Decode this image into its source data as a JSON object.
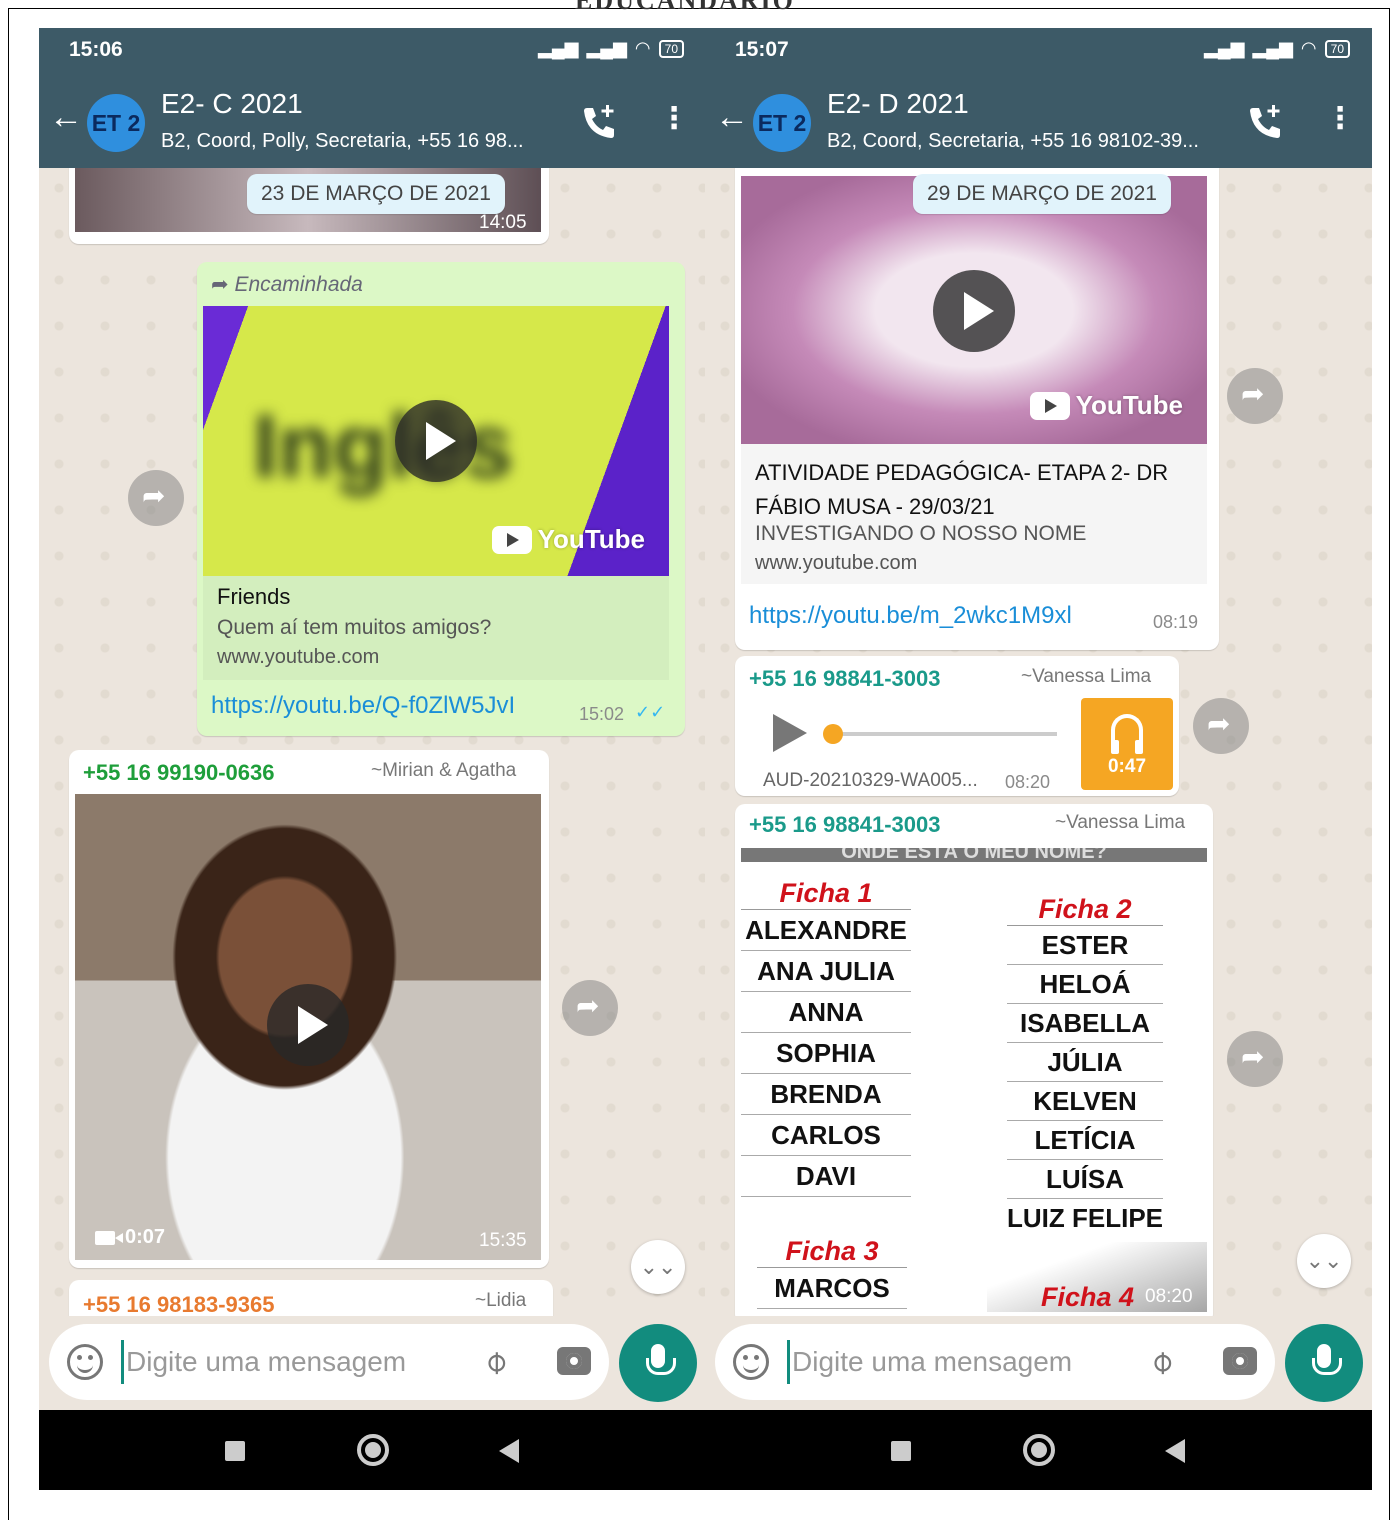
{
  "watermark": "EDUCANDARIO",
  "left": {
    "status": {
      "time": "15:06",
      "battery": "70"
    },
    "header": {
      "avatar": "ET 2",
      "title": "E2- C 2021",
      "subtitle": "B2, Coord, Polly, Secretaria, +55 16 98..."
    },
    "date_chip": "23 DE MARÇO DE 2021",
    "top_media_time": "14:05",
    "forwarded": {
      "label": "Encaminhada",
      "thumb_text": "Inglês",
      "youtube": "YouTube",
      "title": "Friends",
      "description": "Quem aí tem muitos amigos?",
      "site": "www.youtube.com",
      "link": "https://youtu.be/Q-f0ZlW5JvI",
      "time": "15:02",
      "ticks": "✓✓"
    },
    "video_msg": {
      "sender_phone": "+55 16 99190-0636",
      "sender_name": "~Mirian & Agatha",
      "duration": "0:07",
      "time": "15:35"
    },
    "last_msg": {
      "sender_phone": "+55 16 98183-9365",
      "sender_name": "~Lidia"
    },
    "input": {
      "placeholder": "Digite uma mensagem"
    },
    "scroll_icon": "⌄⌄"
  },
  "right": {
    "status": {
      "time": "15:07",
      "battery": "70"
    },
    "header": {
      "avatar": "ET 2",
      "title": "E2- D 2021",
      "subtitle": "B2, Coord, Secretaria, +55 16 98102-39..."
    },
    "date_chip": "29 DE MARÇO DE 2021",
    "youtube_msg": {
      "youtube": "YouTube",
      "title": "ATIVIDADE PEDAGÓGICA- ETAPA 2- DR FÁBIO MUSA - 29/03/21",
      "description": "INVESTIGANDO O NOSSO NOME",
      "site": "www.youtube.com",
      "link": "https://youtu.be/m_2wkc1M9xl",
      "time": "08:19"
    },
    "audio_msg": {
      "sender_phone": "+55 16 98841-3003",
      "sender_name": "~Vanessa Lima",
      "file": "AUD-20210329-WA005...",
      "time": "08:20",
      "duration": "0:47",
      "progress": 0.0
    },
    "image_msg": {
      "sender_phone": "+55 16 98841-3003",
      "sender_name": "~Vanessa Lima",
      "top_caption": "ONDE ESTÁ O MEU NOME?",
      "ficha1": {
        "title": "Ficha 1",
        "names": [
          "ALEXANDRE",
          "ANA JULIA",
          "ANNA",
          "SOPHIA",
          "BRENDA",
          "CARLOS",
          "DAVI"
        ]
      },
      "ficha2": {
        "title": "Ficha 2",
        "names": [
          "ESTER",
          "HELOÁ",
          "ISABELLA",
          "JÚLIA",
          "KELVEN",
          "LETÍCIA",
          "LUÍSA",
          "LUIZ FELIPE"
        ]
      },
      "ficha3": {
        "title": "Ficha 3",
        "names": [
          "MARCOS"
        ]
      },
      "ficha4": {
        "title": "Ficha 4"
      },
      "time": "08:20"
    },
    "input": {
      "placeholder": "Digite uma mensagem"
    },
    "scroll_icon": "⌄⌄"
  },
  "colors": {
    "header": "#3d5a67",
    "accent": "#128c7e",
    "link": "#1a8ed8",
    "sender_green": "#1e9e3a",
    "sender_teal": "#1a9a8a",
    "sender_orange": "#e87a2f",
    "audio": "#f5a623"
  }
}
